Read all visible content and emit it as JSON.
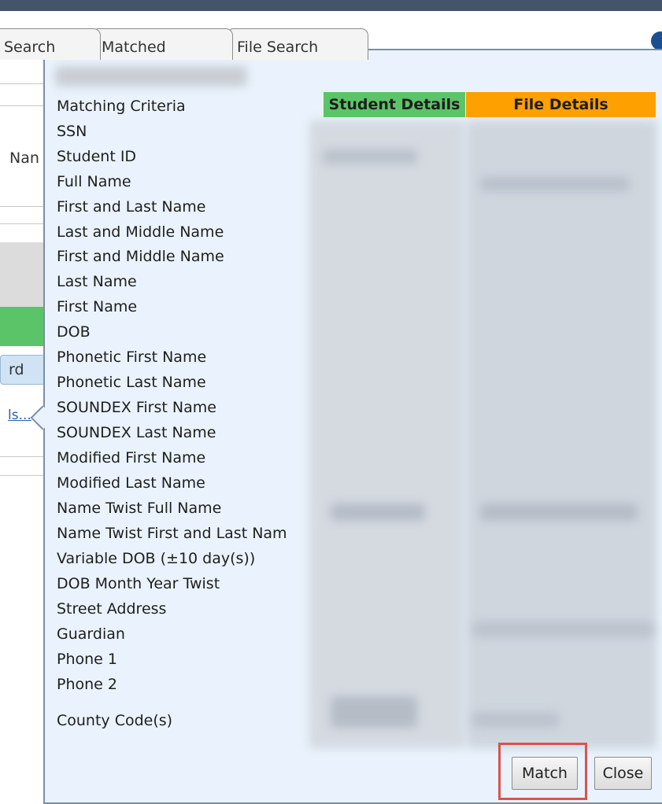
{
  "tabs": [
    {
      "label": "Search"
    },
    {
      "label": "Matched"
    },
    {
      "label": "File Search"
    }
  ],
  "background": {
    "name_fragment": "Nan",
    "button_fragment": "rd",
    "link_fragment": "ls..."
  },
  "dialog": {
    "criteria_header": "Matching Criteria",
    "student_details_header": "Student Details",
    "file_details_header": "File Details",
    "colors": {
      "student_header_bg": "#5cc468",
      "file_header_bg": "#fea000",
      "panel_bg": "#eaf3fd",
      "highlight_border": "#d9534f"
    },
    "criteria": [
      "SSN",
      "Student ID",
      "Full Name",
      "First and Last Name",
      "Last and Middle Name",
      "First and Middle Name",
      "Last Name",
      "First Name",
      "DOB",
      "Phonetic First Name",
      "Phonetic Last Name",
      "SOUNDEX First Name",
      "SOUNDEX Last Name",
      "Modified First Name",
      "Modified Last Name",
      "Name Twist Full Name",
      "Name Twist First and Last Nam",
      "Variable DOB (±10 day(s))",
      "DOB Month Year Twist",
      "Street Address",
      "Guardian",
      "Phone 1",
      "Phone 2",
      "County Code(s)"
    ],
    "match_button": "Match",
    "close_button": "Close"
  }
}
